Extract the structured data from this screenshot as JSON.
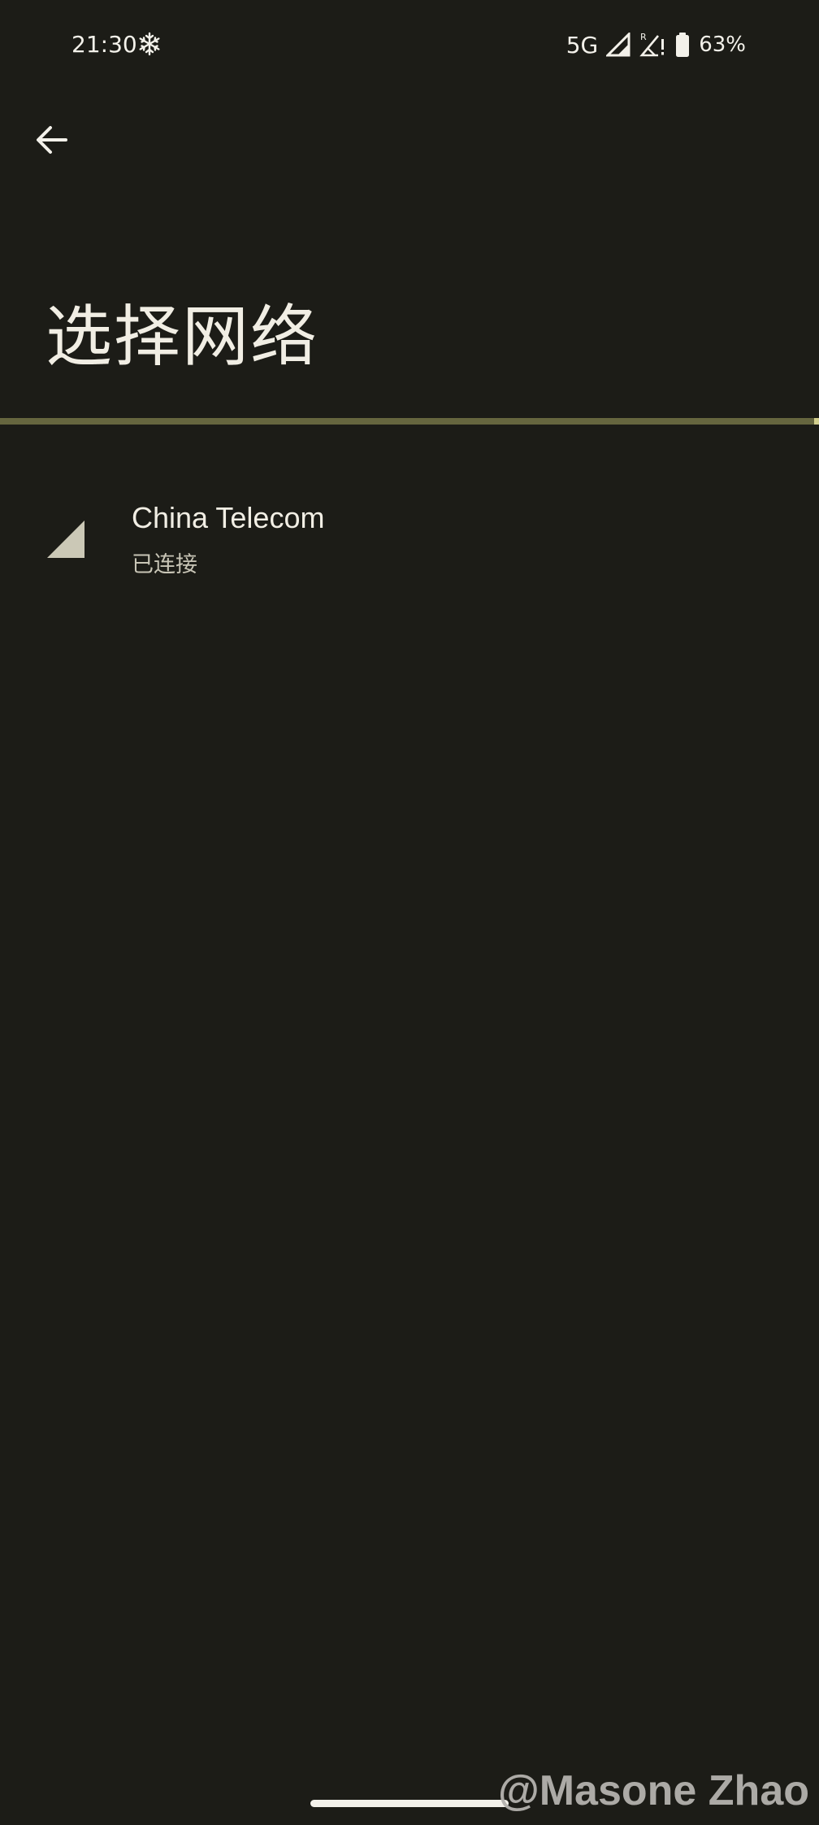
{
  "status_bar": {
    "time": "21:30",
    "left_icon": "snowflake-icon",
    "network_type": "5G",
    "icons": [
      "signal-icon",
      "roaming-signal-alert-icon",
      "battery-icon"
    ],
    "battery_percent": "63%"
  },
  "header": {
    "back_icon": "arrow-left-icon",
    "title": "选择网络"
  },
  "networks": [
    {
      "name": "China Telecom",
      "status": "已连接",
      "icon": "cellular-signal-icon"
    }
  ],
  "watermark": "@Masone Zhao",
  "colors": {
    "background": "#1c1c17",
    "accent_line": "#66663f",
    "text_primary": "#f1eee4",
    "text_secondary": "#c8c5b6"
  }
}
